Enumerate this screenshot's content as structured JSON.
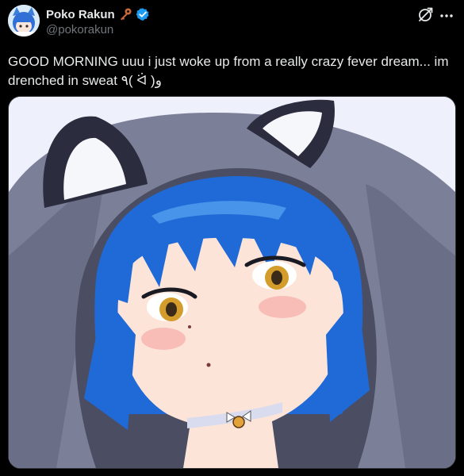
{
  "author": {
    "display_name": "Poko Rakun",
    "handle": "@pokorakun",
    "avatar_icon": "avatar-image",
    "badges": [
      "key-icon",
      "verified-icon"
    ]
  },
  "header_actions": {
    "grok_icon": "grok-icon",
    "more_icon": "more-icon"
  },
  "tweet": {
    "text": "GOOD MORNING uuu i just woke up from a really crazy fever dream... im drenched in sweat ٩( ᐛ )و"
  },
  "media": {
    "kind": "illustration",
    "subject_icon": "anime-girl-illustration"
  },
  "colors": {
    "background": "#000000",
    "text": "#e7e9ea",
    "secondary_text": "#71767b",
    "verified": "#1d9bf0",
    "key": "#c96a3c"
  }
}
